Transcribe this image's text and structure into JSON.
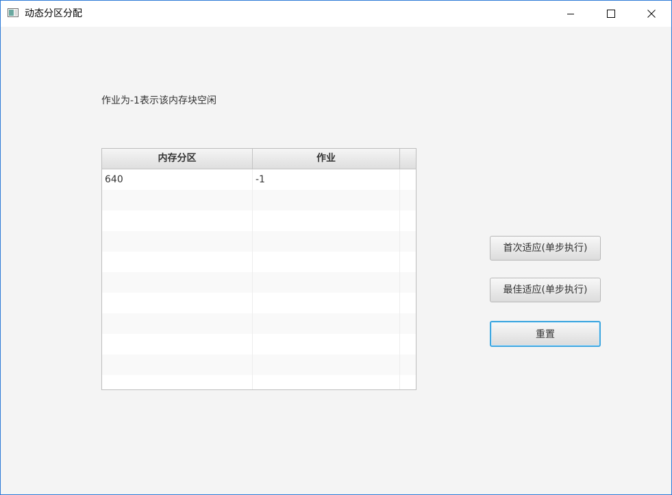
{
  "window": {
    "title": "动态分区分配",
    "controls": [
      "minimize-icon",
      "maximize-icon",
      "close-icon"
    ]
  },
  "hint": "作业为-1表示该内存块空闲",
  "table": {
    "columns": [
      "内存分区",
      "作业"
    ],
    "rows": [
      {
        "partition": "640",
        "job": "-1"
      }
    ]
  },
  "buttons": {
    "first_fit": "首次适应(单步执行)",
    "best_fit": "最佳适应(单步执行)",
    "reset": "重置"
  },
  "colors": {
    "window_border": "#2b79d6",
    "focus_ring": "#3fa7e0",
    "background": "#f4f4f4"
  }
}
